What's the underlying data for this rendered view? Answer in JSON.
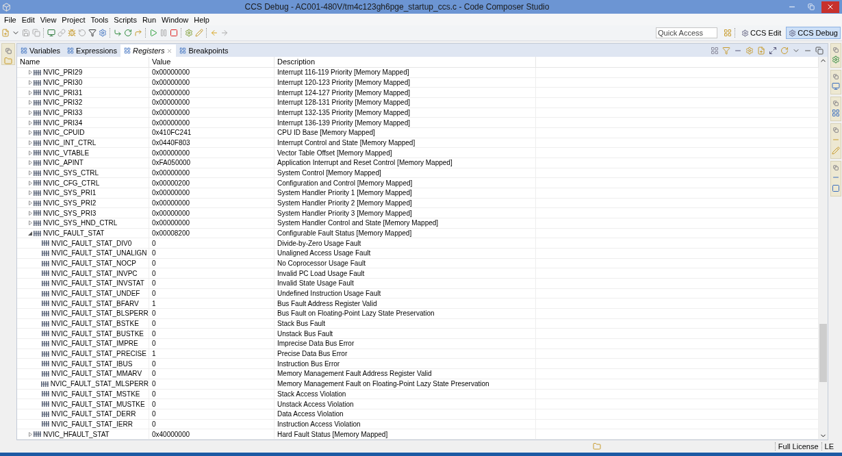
{
  "window": {
    "title": "CCS Debug - AC001-480V/tm4c123gh6pge_startup_ccs.c - Code Composer Studio"
  },
  "menu": [
    "File",
    "Edit",
    "View",
    "Project",
    "Tools",
    "Scripts",
    "Run",
    "Window",
    "Help"
  ],
  "quick_access": {
    "placeholder": "Quick Access"
  },
  "perspectives": [
    {
      "label": "CCS Edit",
      "selected": false
    },
    {
      "label": "CCS Debug",
      "selected": true
    }
  ],
  "tabs": [
    {
      "label": "Variables",
      "selected": false
    },
    {
      "label": "Expressions",
      "selected": false
    },
    {
      "label": "Registers",
      "selected": true
    },
    {
      "label": "Breakpoints",
      "selected": false
    }
  ],
  "table": {
    "columns": [
      "Name",
      "Value",
      "Description"
    ],
    "rows": [
      {
        "name": "NVIC_PRI29",
        "value": "0x00000000",
        "description": "Interrupt 116-119 Priority [Memory Mapped]",
        "expanded": false
      },
      {
        "name": "NVIC_PRI30",
        "value": "0x00000000",
        "description": "Interrupt 120-123 Priority [Memory Mapped]",
        "expanded": false
      },
      {
        "name": "NVIC_PRI31",
        "value": "0x00000000",
        "description": "Interrupt 124-127 Priority [Memory Mapped]",
        "expanded": false
      },
      {
        "name": "NVIC_PRI32",
        "value": "0x00000000",
        "description": "Interrupt 128-131 Priority [Memory Mapped]",
        "expanded": false
      },
      {
        "name": "NVIC_PRI33",
        "value": "0x00000000",
        "description": "Interrupt 132-135 Priority [Memory Mapped]",
        "expanded": false
      },
      {
        "name": "NVIC_PRI34",
        "value": "0x00000000",
        "description": "Interrupt 136-139 Priority [Memory Mapped]",
        "expanded": false
      },
      {
        "name": "NVIC_CPUID",
        "value": "0x410FC241",
        "description": "CPU ID Base [Memory Mapped]",
        "expanded": false
      },
      {
        "name": "NVIC_INT_CTRL",
        "value": "0x0440F803",
        "description": "Interrupt Control and State [Memory Mapped]",
        "expanded": false
      },
      {
        "name": "NVIC_VTABLE",
        "value": "0x00000000",
        "description": "Vector Table Offset [Memory Mapped]",
        "expanded": false
      },
      {
        "name": "NVIC_APINT",
        "value": "0xFA050000",
        "description": "Application Interrupt and Reset Control [Memory Mapped]",
        "expanded": false
      },
      {
        "name": "NVIC_SYS_CTRL",
        "value": "0x00000000",
        "description": "System Control [Memory Mapped]",
        "expanded": false
      },
      {
        "name": "NVIC_CFG_CTRL",
        "value": "0x00000200",
        "description": "Configuration and Control [Memory Mapped]",
        "expanded": false
      },
      {
        "name": "NVIC_SYS_PRI1",
        "value": "0x00000000",
        "description": "System Handler Priority 1 [Memory Mapped]",
        "expanded": false
      },
      {
        "name": "NVIC_SYS_PRI2",
        "value": "0x00000000",
        "description": "System Handler Priority 2 [Memory Mapped]",
        "expanded": false
      },
      {
        "name": "NVIC_SYS_PRI3",
        "value": "0x00000000",
        "description": "System Handler Priority 3 [Memory Mapped]",
        "expanded": false
      },
      {
        "name": "NVIC_SYS_HND_CTRL",
        "value": "0x00000000",
        "description": "System Handler Control and State [Memory Mapped]",
        "expanded": false
      },
      {
        "name": "NVIC_FAULT_STAT",
        "value": "0x00008200",
        "description": "Configurable Fault Status [Memory Mapped]",
        "expanded": true,
        "children": [
          {
            "name": "NVIC_FAULT_STAT_DIV0",
            "value": "0",
            "description": "Divide-by-Zero Usage Fault"
          },
          {
            "name": "NVIC_FAULT_STAT_UNALIGN",
            "value": "0",
            "description": "Unaligned Access Usage Fault"
          },
          {
            "name": "NVIC_FAULT_STAT_NOCP",
            "value": "0",
            "description": "No Coprocessor Usage Fault"
          },
          {
            "name": "NVIC_FAULT_STAT_INVPC",
            "value": "0",
            "description": "Invalid PC Load Usage Fault"
          },
          {
            "name": "NVIC_FAULT_STAT_INVSTAT",
            "value": "0",
            "description": "Invalid State Usage Fault"
          },
          {
            "name": "NVIC_FAULT_STAT_UNDEF",
            "value": "0",
            "description": "Undefined Instruction Usage Fault"
          },
          {
            "name": "NVIC_FAULT_STAT_BFARV",
            "value": "1",
            "description": "Bus Fault Address Register Valid"
          },
          {
            "name": "NVIC_FAULT_STAT_BLSPERR",
            "value": "0",
            "description": "Bus Fault on Floating-Point Lazy State Preservation"
          },
          {
            "name": "NVIC_FAULT_STAT_BSTKE",
            "value": "0",
            "description": "Stack Bus Fault"
          },
          {
            "name": "NVIC_FAULT_STAT_BUSTKE",
            "value": "0",
            "description": "Unstack Bus Fault"
          },
          {
            "name": "NVIC_FAULT_STAT_IMPRE",
            "value": "0",
            "description": "Imprecise Data Bus Error"
          },
          {
            "name": "NVIC_FAULT_STAT_PRECISE",
            "value": "1",
            "description": "Precise Data Bus Error"
          },
          {
            "name": "NVIC_FAULT_STAT_IBUS",
            "value": "0",
            "description": "Instruction Bus Error"
          },
          {
            "name": "NVIC_FAULT_STAT_MMARV",
            "value": "0",
            "description": "Memory Management Fault Address Register Valid"
          },
          {
            "name": "NVIC_FAULT_STAT_MLSPERR",
            "value": "0",
            "description": "Memory Management Fault on Floating-Point Lazy State Preservation"
          },
          {
            "name": "NVIC_FAULT_STAT_MSTKE",
            "value": "0",
            "description": "Stack Access Violation"
          },
          {
            "name": "NVIC_FAULT_STAT_MUSTKE",
            "value": "0",
            "description": "Unstack Access Violation"
          },
          {
            "name": "NVIC_FAULT_STAT_DERR",
            "value": "0",
            "description": "Data Access Violation"
          },
          {
            "name": "NVIC_FAULT_STAT_IERR",
            "value": "0",
            "description": "Instruction Access Violation"
          }
        ]
      },
      {
        "name": "NVIC_HFAULT_STAT",
        "value": "0x40000000",
        "description": "Hard Fault Status [Memory Mapped]",
        "expanded": false
      }
    ]
  },
  "status_bar": [
    "Full License",
    "LE"
  ]
}
